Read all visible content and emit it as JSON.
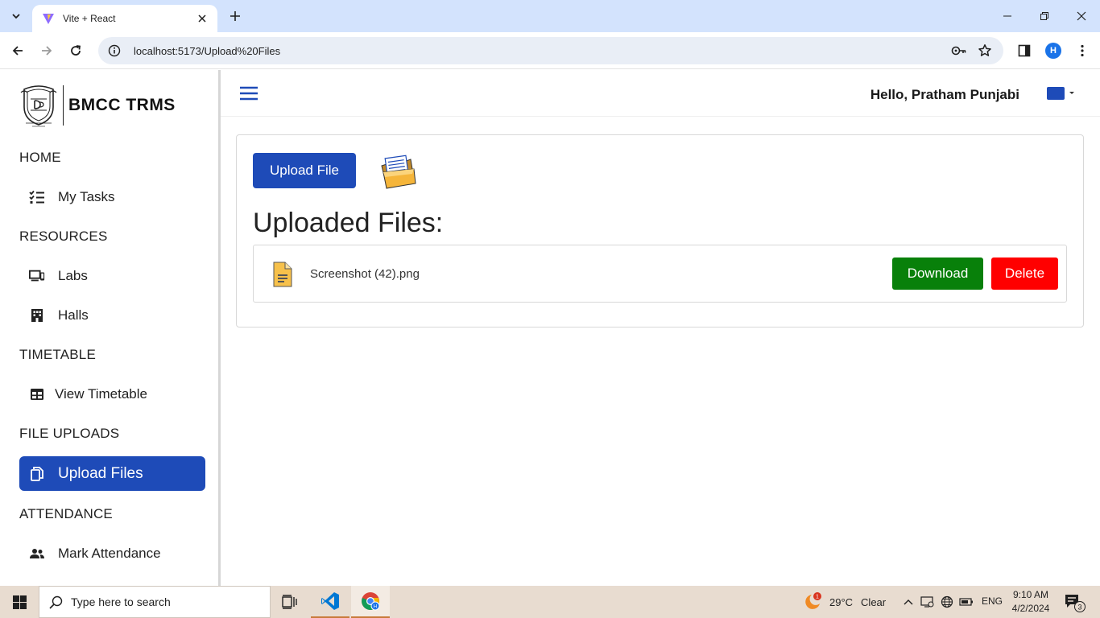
{
  "browser": {
    "tab_title": "Vite + React",
    "url": "localhost:5173/Upload%20Files",
    "profile_initial": "H"
  },
  "brand": {
    "name": "BMCC TRMS"
  },
  "sidebar": {
    "sections": [
      {
        "heading": "HOME",
        "items": [
          {
            "label": "My Tasks",
            "icon": "task-list-icon"
          }
        ]
      },
      {
        "heading": "RESOURCES",
        "items": [
          {
            "label": "Labs",
            "icon": "devices-icon"
          },
          {
            "label": "Halls",
            "icon": "building-icon"
          }
        ]
      },
      {
        "heading": "TIMETABLE",
        "items": [
          {
            "label": "View Timetable",
            "icon": "table-icon"
          }
        ]
      },
      {
        "heading": "FILE UPLOADS",
        "items": [
          {
            "label": "Upload Files",
            "icon": "copy-file-icon",
            "active": true
          }
        ]
      },
      {
        "heading": "ATTENDANCE",
        "items": [
          {
            "label": "Mark Attendance",
            "icon": "people-icon"
          }
        ]
      }
    ]
  },
  "header": {
    "greeting": "Hello, Pratham Punjabi"
  },
  "main": {
    "upload_button": "Upload File",
    "files_title": "Uploaded Files:",
    "files": [
      {
        "name": "Screenshot (42).png",
        "download_label": "Download",
        "delete_label": "Delete"
      }
    ]
  },
  "colors": {
    "primary": "#1e4bb8",
    "download": "#08800a",
    "delete": "#ff0000"
  },
  "taskbar": {
    "search_placeholder": "Type here to search",
    "weather_temp": "29°C",
    "weather_desc": "Clear",
    "weather_badge": "1",
    "language": "ENG",
    "time": "9:10 AM",
    "date": "4/2/2024",
    "notification_count": "3"
  }
}
